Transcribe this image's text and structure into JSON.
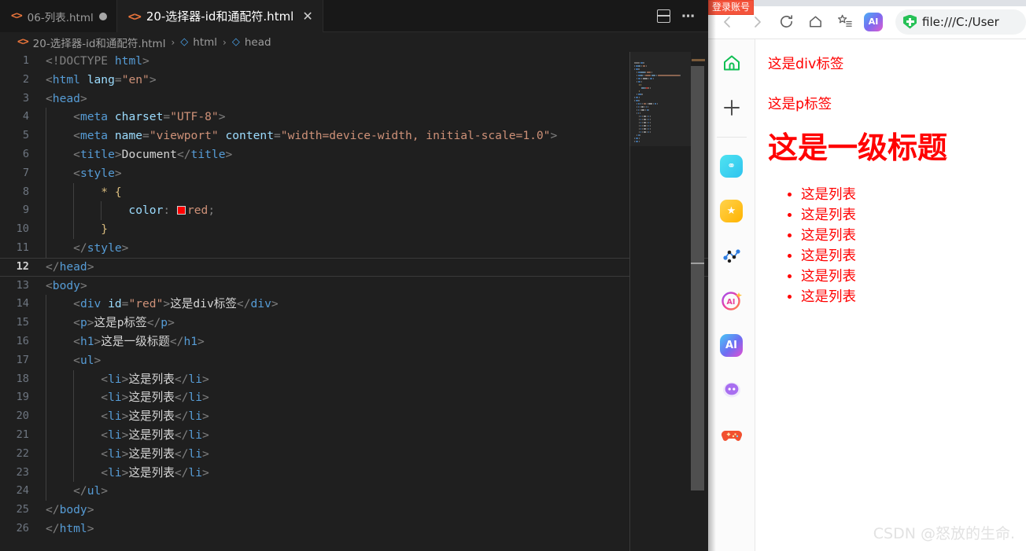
{
  "editor": {
    "tabs": [
      {
        "label": "06-列表.html",
        "icon": "html-file-icon",
        "dirty": true,
        "active": false,
        "closable": false
      },
      {
        "label": "20-选择器-id和通配符.html",
        "icon": "html-file-icon",
        "dirty": false,
        "active": true,
        "closable": true
      }
    ],
    "tab_close_glyph": "✕",
    "actions": {
      "split_editor": "split-editor-icon",
      "more_actions": "⋯"
    },
    "breadcrumb": {
      "separator": "›",
      "items": [
        {
          "label": "20-选择器-id和通配符.html",
          "icon": "html-file-icon"
        },
        {
          "label": "html",
          "icon": "symbol-cube-icon"
        },
        {
          "label": "head",
          "icon": "symbol-cube-icon"
        }
      ]
    },
    "current_line": 12,
    "color_swatch": "#ff0000",
    "lines": [
      {
        "n": 1,
        "indent": 0,
        "tokens": [
          {
            "c": "punct",
            "t": "<!DOCTYPE "
          },
          {
            "c": "tag",
            "t": "html"
          },
          {
            "c": "punct",
            "t": ">"
          }
        ]
      },
      {
        "n": 2,
        "indent": 0,
        "tokens": [
          {
            "c": "punct",
            "t": "<"
          },
          {
            "c": "tag",
            "t": "html"
          },
          {
            "c": "attr",
            "t": " lang"
          },
          {
            "c": "punct",
            "t": "="
          },
          {
            "c": "str",
            "t": "\"en\""
          },
          {
            "c": "punct",
            "t": ">"
          }
        ]
      },
      {
        "n": 3,
        "indent": 0,
        "tokens": [
          {
            "c": "punct",
            "t": "<"
          },
          {
            "c": "tag",
            "t": "head"
          },
          {
            "c": "punct",
            "t": ">"
          }
        ]
      },
      {
        "n": 4,
        "indent": 1,
        "tokens": [
          {
            "c": "punct",
            "t": "    <"
          },
          {
            "c": "tag",
            "t": "meta"
          },
          {
            "c": "attr",
            "t": " charset"
          },
          {
            "c": "punct",
            "t": "="
          },
          {
            "c": "str",
            "t": "\"UTF-8\""
          },
          {
            "c": "punct",
            "t": ">"
          }
        ]
      },
      {
        "n": 5,
        "indent": 1,
        "tokens": [
          {
            "c": "punct",
            "t": "    <"
          },
          {
            "c": "tag",
            "t": "meta"
          },
          {
            "c": "attr",
            "t": " name"
          },
          {
            "c": "punct",
            "t": "="
          },
          {
            "c": "str",
            "t": "\"viewport\""
          },
          {
            "c": "attr",
            "t": " content"
          },
          {
            "c": "punct",
            "t": "="
          },
          {
            "c": "str",
            "t": "\"width=device-width, initial-scale=1.0\""
          },
          {
            "c": "punct",
            "t": ">"
          }
        ]
      },
      {
        "n": 6,
        "indent": 1,
        "tokens": [
          {
            "c": "punct",
            "t": "    <"
          },
          {
            "c": "tag",
            "t": "title"
          },
          {
            "c": "punct",
            "t": ">"
          },
          {
            "c": "txt",
            "t": "Document"
          },
          {
            "c": "punct",
            "t": "</"
          },
          {
            "c": "tag",
            "t": "title"
          },
          {
            "c": "punct",
            "t": ">"
          }
        ]
      },
      {
        "n": 7,
        "indent": 1,
        "tokens": [
          {
            "c": "punct",
            "t": "    <"
          },
          {
            "c": "tag",
            "t": "style"
          },
          {
            "c": "punct",
            "t": ">"
          }
        ]
      },
      {
        "n": 8,
        "indent": 2,
        "tokens": [
          {
            "c": "sel",
            "t": "        * "
          },
          {
            "c": "brace",
            "t": "{"
          }
        ]
      },
      {
        "n": 9,
        "indent": 3,
        "tokens": [
          {
            "c": "prop",
            "t": "            color"
          },
          {
            "c": "punct",
            "t": ": "
          },
          {
            "c": "swatch",
            "t": ""
          },
          {
            "c": "val",
            "t": "red"
          },
          {
            "c": "punct",
            "t": ";"
          }
        ]
      },
      {
        "n": 10,
        "indent": 2,
        "tokens": [
          {
            "c": "brace",
            "t": "        }"
          }
        ]
      },
      {
        "n": 11,
        "indent": 1,
        "tokens": [
          {
            "c": "punct",
            "t": "    </"
          },
          {
            "c": "tag",
            "t": "style"
          },
          {
            "c": "punct",
            "t": ">"
          }
        ]
      },
      {
        "n": 12,
        "indent": 0,
        "tokens": [
          {
            "c": "punct",
            "t": "</"
          },
          {
            "c": "tag",
            "t": "head"
          },
          {
            "c": "punct",
            "t": ">"
          }
        ]
      },
      {
        "n": 13,
        "indent": 0,
        "tokens": [
          {
            "c": "punct",
            "t": "<"
          },
          {
            "c": "tag",
            "t": "body"
          },
          {
            "c": "punct",
            "t": ">"
          }
        ]
      },
      {
        "n": 14,
        "indent": 1,
        "tokens": [
          {
            "c": "punct",
            "t": "    <"
          },
          {
            "c": "tag",
            "t": "div"
          },
          {
            "c": "attr",
            "t": " id"
          },
          {
            "c": "punct",
            "t": "="
          },
          {
            "c": "str",
            "t": "\"red\""
          },
          {
            "c": "punct",
            "t": ">"
          },
          {
            "c": "txt",
            "t": "这是div标签"
          },
          {
            "c": "punct",
            "t": "</"
          },
          {
            "c": "tag",
            "t": "div"
          },
          {
            "c": "punct",
            "t": ">"
          }
        ]
      },
      {
        "n": 15,
        "indent": 1,
        "tokens": [
          {
            "c": "punct",
            "t": "    <"
          },
          {
            "c": "tag",
            "t": "p"
          },
          {
            "c": "punct",
            "t": ">"
          },
          {
            "c": "txt",
            "t": "这是p标签"
          },
          {
            "c": "punct",
            "t": "</"
          },
          {
            "c": "tag",
            "t": "p"
          },
          {
            "c": "punct",
            "t": ">"
          }
        ]
      },
      {
        "n": 16,
        "indent": 1,
        "tokens": [
          {
            "c": "punct",
            "t": "    <"
          },
          {
            "c": "tag",
            "t": "h1"
          },
          {
            "c": "punct",
            "t": ">"
          },
          {
            "c": "txt",
            "t": "这是一级标题"
          },
          {
            "c": "punct",
            "t": "</"
          },
          {
            "c": "tag",
            "t": "h1"
          },
          {
            "c": "punct",
            "t": ">"
          }
        ]
      },
      {
        "n": 17,
        "indent": 1,
        "tokens": [
          {
            "c": "punct",
            "t": "    <"
          },
          {
            "c": "tag",
            "t": "ul"
          },
          {
            "c": "punct",
            "t": ">"
          }
        ]
      },
      {
        "n": 18,
        "indent": 2,
        "tokens": [
          {
            "c": "punct",
            "t": "        <"
          },
          {
            "c": "tag",
            "t": "li"
          },
          {
            "c": "punct",
            "t": ">"
          },
          {
            "c": "txt",
            "t": "这是列表"
          },
          {
            "c": "punct",
            "t": "</"
          },
          {
            "c": "tag",
            "t": "li"
          },
          {
            "c": "punct",
            "t": ">"
          }
        ]
      },
      {
        "n": 19,
        "indent": 2,
        "tokens": [
          {
            "c": "punct",
            "t": "        <"
          },
          {
            "c": "tag",
            "t": "li"
          },
          {
            "c": "punct",
            "t": ">"
          },
          {
            "c": "txt",
            "t": "这是列表"
          },
          {
            "c": "punct",
            "t": "</"
          },
          {
            "c": "tag",
            "t": "li"
          },
          {
            "c": "punct",
            "t": ">"
          }
        ]
      },
      {
        "n": 20,
        "indent": 2,
        "tokens": [
          {
            "c": "punct",
            "t": "        <"
          },
          {
            "c": "tag",
            "t": "li"
          },
          {
            "c": "punct",
            "t": ">"
          },
          {
            "c": "txt",
            "t": "这是列表"
          },
          {
            "c": "punct",
            "t": "</"
          },
          {
            "c": "tag",
            "t": "li"
          },
          {
            "c": "punct",
            "t": ">"
          }
        ]
      },
      {
        "n": 21,
        "indent": 2,
        "tokens": [
          {
            "c": "punct",
            "t": "        <"
          },
          {
            "c": "tag",
            "t": "li"
          },
          {
            "c": "punct",
            "t": ">"
          },
          {
            "c": "txt",
            "t": "这是列表"
          },
          {
            "c": "punct",
            "t": "</"
          },
          {
            "c": "tag",
            "t": "li"
          },
          {
            "c": "punct",
            "t": ">"
          }
        ]
      },
      {
        "n": 22,
        "indent": 2,
        "tokens": [
          {
            "c": "punct",
            "t": "        <"
          },
          {
            "c": "tag",
            "t": "li"
          },
          {
            "c": "punct",
            "t": ">"
          },
          {
            "c": "txt",
            "t": "这是列表"
          },
          {
            "c": "punct",
            "t": "</"
          },
          {
            "c": "tag",
            "t": "li"
          },
          {
            "c": "punct",
            "t": ">"
          }
        ]
      },
      {
        "n": 23,
        "indent": 2,
        "tokens": [
          {
            "c": "punct",
            "t": "        <"
          },
          {
            "c": "tag",
            "t": "li"
          },
          {
            "c": "punct",
            "t": ">"
          },
          {
            "c": "txt",
            "t": "这是列表"
          },
          {
            "c": "punct",
            "t": "</"
          },
          {
            "c": "tag",
            "t": "li"
          },
          {
            "c": "punct",
            "t": ">"
          }
        ]
      },
      {
        "n": 24,
        "indent": 1,
        "tokens": [
          {
            "c": "punct",
            "t": "    </"
          },
          {
            "c": "tag",
            "t": "ul"
          },
          {
            "c": "punct",
            "t": ">"
          }
        ]
      },
      {
        "n": 25,
        "indent": 0,
        "tokens": [
          {
            "c": "punct",
            "t": "</"
          },
          {
            "c": "tag",
            "t": "body"
          },
          {
            "c": "punct",
            "t": ">"
          }
        ]
      },
      {
        "n": 26,
        "indent": 0,
        "tokens": [
          {
            "c": "punct",
            "t": "</"
          },
          {
            "c": "tag",
            "t": "html"
          },
          {
            "c": "punct",
            "t": ">"
          }
        ]
      }
    ]
  },
  "browser": {
    "login_badge": "登录账号",
    "toolbar": [
      {
        "name": "back-button",
        "glyph": "←",
        "disabled": true
      },
      {
        "name": "forward-button",
        "glyph": "→",
        "disabled": true
      },
      {
        "name": "reload-button",
        "glyph": "⟳",
        "disabled": false
      },
      {
        "name": "home-button",
        "glyph": "⌂",
        "disabled": false
      },
      {
        "name": "collections-button",
        "glyph": "☆",
        "disabled": false
      },
      {
        "name": "copilot-button",
        "glyph": "AI",
        "disabled": false
      }
    ],
    "address": {
      "value": "file:///C:/User",
      "security_icon": "shield-check-icon"
    },
    "rail": [
      {
        "name": "rail-home-icon",
        "glyph": "⌂",
        "style": "home"
      },
      {
        "name": "rail-add-icon",
        "glyph": "+",
        "style": "plain"
      },
      {
        "name": "rail-divider",
        "glyph": "",
        "style": "sep"
      },
      {
        "name": "rail-app-icon",
        "glyph": "⊕",
        "style": "cyan"
      },
      {
        "name": "rail-favorites-icon",
        "glyph": "★",
        "style": "yellow"
      },
      {
        "name": "rail-graph-icon",
        "glyph": "",
        "style": "graph"
      },
      {
        "name": "rail-ai-circle-icon",
        "glyph": "AI",
        "style": "ring"
      },
      {
        "name": "rail-ai-icon",
        "glyph": "AI",
        "style": "blue"
      },
      {
        "name": "rail-bot-icon",
        "glyph": "",
        "style": "purple"
      },
      {
        "name": "rail-game-icon",
        "glyph": "",
        "style": "gamepad"
      }
    ],
    "page": {
      "div_text": "这是div标签",
      "p_text": "这是p标签",
      "h1_text": "这是一级标题",
      "list_items": [
        "这是列表",
        "这是列表",
        "这是列表",
        "这是列表",
        "这是列表",
        "这是列表"
      ],
      "text_color": "#ff0000"
    },
    "watermark": "CSDN @怒放的生命."
  }
}
